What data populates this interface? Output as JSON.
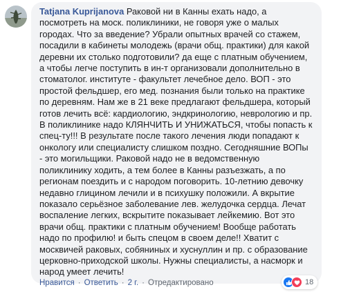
{
  "comment": {
    "author": "Tatjana Kuprijanova",
    "text": "Раковой ни в Канны ехать надо, а посмотреть на моск. поликлиники, не говоря уже о малых городах. Что за введение? Убрали опытных врачей со стажем, посадили в кабинеты молодежь (врачи общ. практики) для какой деревни их столько подготовили? да еще с платным обучением, а чтобы легче поступить в ин-т организовали дополнительно в стоматолог. институте - факультет лечебное дело. ВОП - это простой фельдшер, его мед. познания были только на практике по деревням. Нам же в 21 веке предлагают фельдшера, который готов лечить всё: кардиологию, эндкринологию, неврологию и пр. В поликлинике надо КЛЯНЧИТЬ И УНИЖАТЬСЯ, чтобы попасть к спец-ту!!! В результате после такого лечения люди попадают к онкологу или специалисту слишком поздно. Сегодняшние ВОПы - это могильщики. Раковой надо не в ведомственную поликлинику ходить, а тем более в Канны разъезжать, а по регионам поездить и с народом поговорить. 10-летнию девочку недавно глицином лечили и в психушку положили. А вкрытие показало серьёзное заболевание лев. желудочка сердца. Лечат воспаление легких, вскрытите показывает лейкемию. Вот это врачи общ. практики с платным обучением! Вообще работать надо по профилю! и быть спецом в своем деле!! Хватит с москвичей раковых, собяниных и хуснуллин и пр. с образование церковно-приходской школы. Нужны специалисты, а насморк и народ умеет лечить!"
  },
  "actions": {
    "like": "Нравится",
    "reply": "Ответить",
    "time": "2 г.",
    "edited": "Отредактировано",
    "separator": "·"
  },
  "reactions": {
    "count": "18",
    "icons": [
      "like-icon",
      "love-icon"
    ],
    "colors": {
      "like": "#1877f2",
      "love": "#f33e58"
    }
  },
  "colors": {
    "author_link": "#385898",
    "bubble_bg": "#f2f3f5",
    "meta_text": "#606770"
  }
}
